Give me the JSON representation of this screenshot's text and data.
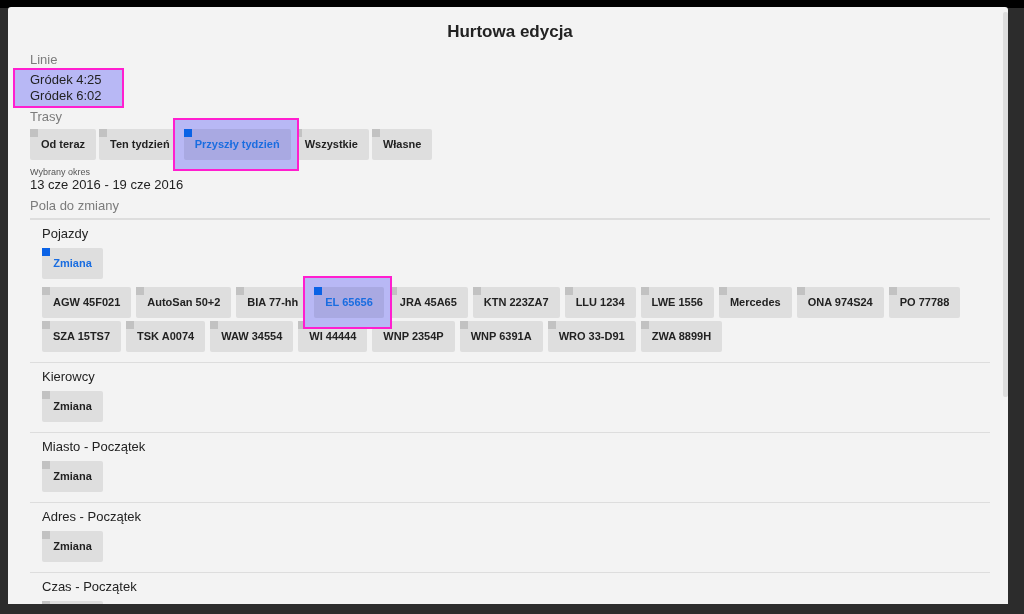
{
  "dialog": {
    "title": "Hurtowa edycja",
    "lines": {
      "label": "Linie",
      "highlighted": true,
      "items": [
        "Gródek 4:25",
        "Gródek 6:02"
      ]
    },
    "routes": {
      "label": "Trasy",
      "options": [
        {
          "label": "Od teraz",
          "selected": false,
          "highlighted": false
        },
        {
          "label": "Ten tydzień",
          "selected": false,
          "highlighted": false
        },
        {
          "label": "Przyszły tydzień",
          "selected": true,
          "highlighted": true
        },
        {
          "label": "Wszystkie",
          "selected": false,
          "highlighted": false
        },
        {
          "label": "Własne",
          "selected": false,
          "highlighted": false
        }
      ]
    },
    "period": {
      "label": "Wybrany okres",
      "value": "13 cze 2016 - 19 cze 2016"
    },
    "fields": {
      "label": "Pola do zmiany",
      "sections": [
        {
          "title": "Pojazdy",
          "change": {
            "label": "Zmiana",
            "selected": true
          },
          "options": [
            {
              "label": "AGW 45F021",
              "selected": false,
              "highlighted": false
            },
            {
              "label": "AutoSan 50+2",
              "selected": false,
              "highlighted": false
            },
            {
              "label": "BIA 77-hh",
              "selected": false,
              "highlighted": false
            },
            {
              "label": "EL 65656",
              "selected": true,
              "highlighted": true
            },
            {
              "label": "JRA 45A65",
              "selected": false,
              "highlighted": false
            },
            {
              "label": "KTN 223ZA7",
              "selected": false,
              "highlighted": false
            },
            {
              "label": "LLU 1234",
              "selected": false,
              "highlighted": false
            },
            {
              "label": "LWE 1556",
              "selected": false,
              "highlighted": false
            },
            {
              "label": "Mercedes",
              "selected": false,
              "highlighted": false
            },
            {
              "label": "ONA 974S24",
              "selected": false,
              "highlighted": false
            },
            {
              "label": "PO 77788",
              "selected": false,
              "highlighted": false
            },
            {
              "label": "SZA 15TS7",
              "selected": false,
              "highlighted": false
            },
            {
              "label": "TSK A0074",
              "selected": false,
              "highlighted": false
            },
            {
              "label": "WAW 34554",
              "selected": false,
              "highlighted": false
            },
            {
              "label": "WI 44444",
              "selected": false,
              "highlighted": false
            },
            {
              "label": "WNP 2354P",
              "selected": false,
              "highlighted": false
            },
            {
              "label": "WNP 6391A",
              "selected": false,
              "highlighted": false
            },
            {
              "label": "WRO 33-D91",
              "selected": false,
              "highlighted": false
            },
            {
              "label": "ZWA 8899H",
              "selected": false,
              "highlighted": false
            }
          ]
        },
        {
          "title": "Kierowcy",
          "change": {
            "label": "Zmiana",
            "selected": false
          }
        },
        {
          "title": "Miasto - Początek",
          "change": {
            "label": "Zmiana",
            "selected": false
          }
        },
        {
          "title": "Adres - Początek",
          "change": {
            "label": "Zmiana",
            "selected": false
          }
        },
        {
          "title": "Czas - Początek",
          "change": {
            "selected": false
          }
        }
      ]
    }
  }
}
